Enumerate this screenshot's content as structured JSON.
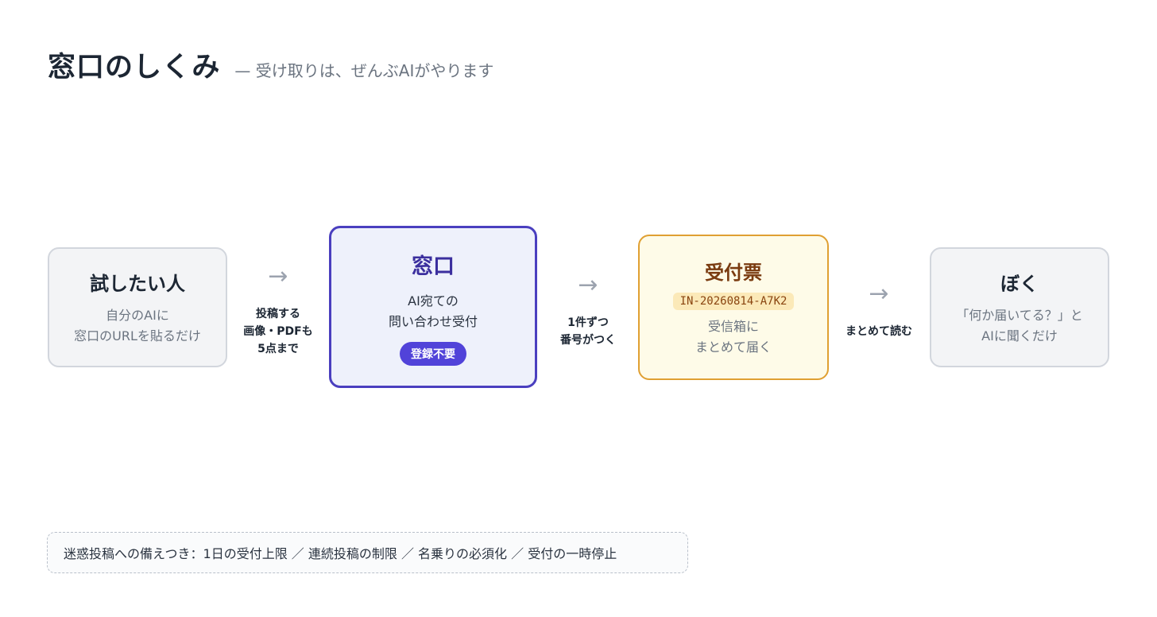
{
  "header": {
    "title": "窓口のしくみ",
    "subtitle": "— 受け取りは、ぜんぶAIがやります"
  },
  "boxes": {
    "user": {
      "title": "試したい人",
      "lines": [
        "自分のAIに",
        "窓口のURLを貼るだけ"
      ]
    },
    "window": {
      "title": "窓口",
      "lines": [
        "AI宛ての",
        "問い合わせ受付"
      ],
      "badge": "登録不要"
    },
    "ticket": {
      "title": "受付票",
      "code": "IN-20260814-A7K2",
      "lines": [
        "受信箱に",
        "まとめて届く"
      ]
    },
    "me": {
      "title": "ぼく",
      "lines": [
        "「何か届いてる？」と",
        "AIに聞くだけ"
      ]
    }
  },
  "steps": [
    {
      "arrow": "→",
      "lines": [
        "投稿する",
        "画像・PDFも",
        "5点まで"
      ]
    },
    {
      "arrow": "→",
      "lines": [
        "1件ずつ",
        "番号がつく"
      ]
    },
    {
      "arrow": "→",
      "lines": [
        "まとめて読む"
      ]
    }
  ],
  "note": "迷惑投稿への備えつき：1日の受付上限 ／ 連続投稿の制限 ／ 名乗りの必須化 ／ 受付の一時停止"
}
